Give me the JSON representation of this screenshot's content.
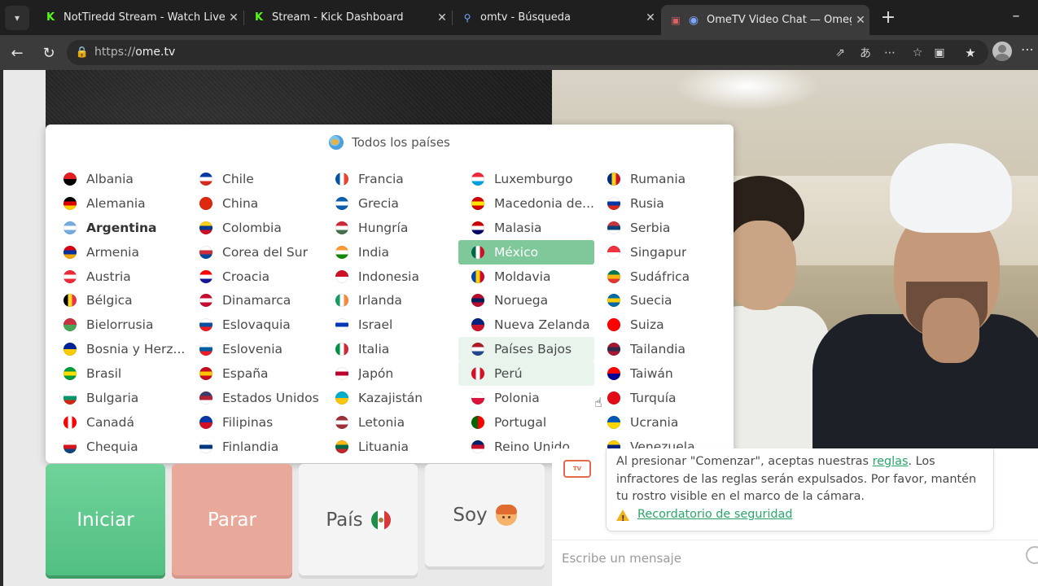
{
  "browser": {
    "tabs": [
      {
        "title": "NotTiredd Stream - Watch Live on",
        "active": false
      },
      {
        "title": "Stream - Kick Dashboard",
        "active": false
      },
      {
        "title": "omtv - Búsqueda",
        "active": false
      },
      {
        "title": "OmeTV Video Chat — Omegle",
        "active": true
      }
    ],
    "url_scheme": "https://",
    "url_host": "ome.tv"
  },
  "country_selector": {
    "header": "Todos los países",
    "columns": [
      [
        {
          "name": "Albania",
          "flag": [
            "#e41e20",
            "#000000"
          ]
        },
        {
          "name": "Alemania",
          "flag": [
            "#000000",
            "#dd0000",
            "#ffce00"
          ]
        },
        {
          "name": "Argentina",
          "flag": [
            "#74acdf",
            "#ffffff",
            "#74acdf"
          ],
          "bold": true
        },
        {
          "name": "Armenia",
          "flag": [
            "#d90012",
            "#0033a0",
            "#f2a800"
          ]
        },
        {
          "name": "Austria",
          "flag": [
            "#ed2939",
            "#ffffff",
            "#ed2939"
          ]
        },
        {
          "name": "Bélgica",
          "flag": [
            "#000000",
            "#fdda24",
            "#ef3340"
          ],
          "vertical": true
        },
        {
          "name": "Bielorrusia",
          "flag": [
            "#c8313e",
            "#4aa657"
          ]
        },
        {
          "name": "Bosnia y Herz...",
          "flag": [
            "#002395",
            "#fecb00"
          ]
        },
        {
          "name": "Brasil",
          "flag": [
            "#009c3b",
            "#ffdf00",
            "#009c3b"
          ]
        },
        {
          "name": "Bulgaria",
          "flag": [
            "#ffffff",
            "#00966e",
            "#d62612"
          ]
        },
        {
          "name": "Canadá",
          "flag": [
            "#ff0000",
            "#ffffff",
            "#ff0000"
          ],
          "vertical": true
        },
        {
          "name": "Chequia",
          "flag": [
            "#ffffff",
            "#d7141a",
            "#11457e"
          ]
        }
      ],
      [
        {
          "name": "Chile",
          "flag": [
            "#0039a6",
            "#ffffff",
            "#d52b1e"
          ]
        },
        {
          "name": "China",
          "flag": [
            "#de2910",
            "#de2910"
          ]
        },
        {
          "name": "Colombia",
          "flag": [
            "#fcd116",
            "#003893",
            "#ce1126"
          ]
        },
        {
          "name": "Corea del Sur",
          "flag": [
            "#ffffff",
            "#cd2e3a",
            "#0047a0"
          ]
        },
        {
          "name": "Croacia",
          "flag": [
            "#ff0000",
            "#ffffff",
            "#171796"
          ]
        },
        {
          "name": "Dinamarca",
          "flag": [
            "#c60c30",
            "#ffffff",
            "#c60c30"
          ]
        },
        {
          "name": "Eslovaquia",
          "flag": [
            "#ffffff",
            "#0b4ea2",
            "#ee1c25"
          ]
        },
        {
          "name": "Eslovenia",
          "flag": [
            "#ffffff",
            "#005da4",
            "#ed1c24"
          ]
        },
        {
          "name": "España",
          "flag": [
            "#c60b1e",
            "#ffc400",
            "#c60b1e"
          ]
        },
        {
          "name": "Estados Unidos",
          "flag": [
            "#3c3b6e",
            "#b22234",
            "#ffffff"
          ]
        },
        {
          "name": "Filipinas",
          "flag": [
            "#0038a8",
            "#ce1126"
          ]
        },
        {
          "name": "Finlandia",
          "flag": [
            "#ffffff",
            "#003580",
            "#ffffff"
          ]
        }
      ],
      [
        {
          "name": "Francia",
          "flag": [
            "#0055a4",
            "#ffffff",
            "#ef4135"
          ],
          "vertical": true
        },
        {
          "name": "Grecia",
          "flag": [
            "#0d5eaf",
            "#ffffff",
            "#0d5eaf"
          ]
        },
        {
          "name": "Hungría",
          "flag": [
            "#ce2939",
            "#ffffff",
            "#477050"
          ]
        },
        {
          "name": "India",
          "flag": [
            "#ff9933",
            "#ffffff",
            "#138808"
          ]
        },
        {
          "name": "Indonesia",
          "flag": [
            "#ce1126",
            "#ffffff"
          ]
        },
        {
          "name": "Irlanda",
          "flag": [
            "#169b62",
            "#ffffff",
            "#ff883e"
          ],
          "vertical": true
        },
        {
          "name": "Israel",
          "flag": [
            "#ffffff",
            "#0038b8",
            "#ffffff"
          ]
        },
        {
          "name": "Italia",
          "flag": [
            "#009246",
            "#ffffff",
            "#ce2b37"
          ],
          "vertical": true
        },
        {
          "name": "Japón",
          "flag": [
            "#ffffff",
            "#bc002d",
            "#ffffff"
          ]
        },
        {
          "name": "Kazajistán",
          "flag": [
            "#00afca",
            "#fec50c"
          ]
        },
        {
          "name": "Letonia",
          "flag": [
            "#9e3039",
            "#ffffff",
            "#9e3039"
          ]
        },
        {
          "name": "Lituania",
          "flag": [
            "#fdb913",
            "#006a44",
            "#c1272d"
          ]
        }
      ],
      [
        {
          "name": "Luxemburgo",
          "flag": [
            "#ed2939",
            "#ffffff",
            "#00a1de"
          ]
        },
        {
          "name": "Macedonia de...",
          "flag": [
            "#d20000",
            "#ffe600",
            "#d20000"
          ]
        },
        {
          "name": "Malasia",
          "flag": [
            "#cc0001",
            "#ffffff",
            "#010066"
          ]
        },
        {
          "name": "México",
          "flag": [
            "#006847",
            "#ffffff",
            "#ce1126"
          ],
          "vertical": true,
          "selected": true
        },
        {
          "name": "Moldavia",
          "flag": [
            "#0046ae",
            "#ffd200",
            "#cc092f"
          ],
          "vertical": true
        },
        {
          "name": "Noruega",
          "flag": [
            "#ba0c2f",
            "#00205b",
            "#ba0c2f"
          ]
        },
        {
          "name": "Nueva Zelanda",
          "flag": [
            "#00247d",
            "#cc142b"
          ]
        },
        {
          "name": "Países Bajos",
          "flag": [
            "#ae1c28",
            "#ffffff",
            "#21468b"
          ],
          "hover": true
        },
        {
          "name": "Perú",
          "flag": [
            "#d91023",
            "#ffffff",
            "#d91023"
          ],
          "vertical": true,
          "hover": true
        },
        {
          "name": "Polonia",
          "flag": [
            "#ffffff",
            "#dc143c"
          ]
        },
        {
          "name": "Portugal",
          "flag": [
            "#006600",
            "#ff0000"
          ],
          "vertical": true
        },
        {
          "name": "Reino Unido",
          "flag": [
            "#012169",
            "#c8102e",
            "#ffffff"
          ]
        }
      ],
      [
        {
          "name": "Rumania",
          "flag": [
            "#002b7f",
            "#fcd116",
            "#ce1126"
          ],
          "vertical": true
        },
        {
          "name": "Rusia",
          "flag": [
            "#ffffff",
            "#0039a6",
            "#d52b1e"
          ]
        },
        {
          "name": "Serbia",
          "flag": [
            "#c6363c",
            "#0c4076",
            "#ffffff"
          ]
        },
        {
          "name": "Singapur",
          "flag": [
            "#ef3340",
            "#ffffff"
          ]
        },
        {
          "name": "Sudáfrica",
          "flag": [
            "#007a4d",
            "#ffb612",
            "#de3831"
          ]
        },
        {
          "name": "Suecia",
          "flag": [
            "#006aa7",
            "#fecc00",
            "#006aa7"
          ]
        },
        {
          "name": "Suiza",
          "flag": [
            "#ff0000",
            "#ff0000"
          ]
        },
        {
          "name": "Tailandia",
          "flag": [
            "#a51931",
            "#2d2a4a",
            "#a51931"
          ]
        },
        {
          "name": "Taiwán",
          "flag": [
            "#fe0000",
            "#000095"
          ]
        },
        {
          "name": "Turquía",
          "flag": [
            "#e30a17",
            "#e30a17"
          ]
        },
        {
          "name": "Ucrania",
          "flag": [
            "#0057b7",
            "#ffd700"
          ]
        },
        {
          "name": "Venezuela",
          "flag": [
            "#ffcc00",
            "#00247d",
            "#cf142b"
          ]
        }
      ]
    ]
  },
  "controls": {
    "start_label": "Iniciar",
    "stop_label": "Parar",
    "country_label": "País",
    "gender_label": "Soy"
  },
  "chat": {
    "logo_text": "TV",
    "rules_text_1": "Al presionar \"Comenzar\", aceptas nuestras ",
    "rules_link": "reglas",
    "rules_text_2": ". Los infractores de las reglas serán expulsados. Por favor, mantén tu rostro visible en el marco de la cámara.",
    "safety_link": "Recordatorio de seguridad",
    "input_placeholder": "Escribe un mensaje"
  }
}
